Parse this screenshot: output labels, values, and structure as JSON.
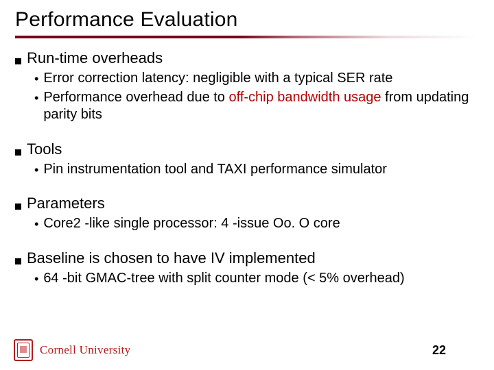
{
  "title": "Performance Evaluation",
  "sections": [
    {
      "heading": "Run-time overheads",
      "items": [
        {
          "pre": "Error correction latency: negligible with a typical SER rate",
          "hl": "",
          "post": ""
        },
        {
          "pre": "Performance overhead due to ",
          "hl": "off-chip bandwidth usage",
          "post": " from updating parity bits"
        }
      ]
    },
    {
      "heading": "Tools",
      "items": [
        {
          "pre": "Pin instrumentation tool and TAXI performance simulator",
          "hl": "",
          "post": ""
        }
      ]
    },
    {
      "heading": "Parameters",
      "items": [
        {
          "pre": "Core2 -like single processor: 4 -issue Oo. O core",
          "hl": "",
          "post": ""
        }
      ]
    },
    {
      "heading": "Baseline is chosen to have IV implemented",
      "items": [
        {
          "pre": "64 -bit GMAC-tree with split counter mode (< 5% overhead)",
          "hl": "",
          "post": ""
        }
      ]
    }
  ],
  "branding": "Cornell University",
  "page_number": "22"
}
